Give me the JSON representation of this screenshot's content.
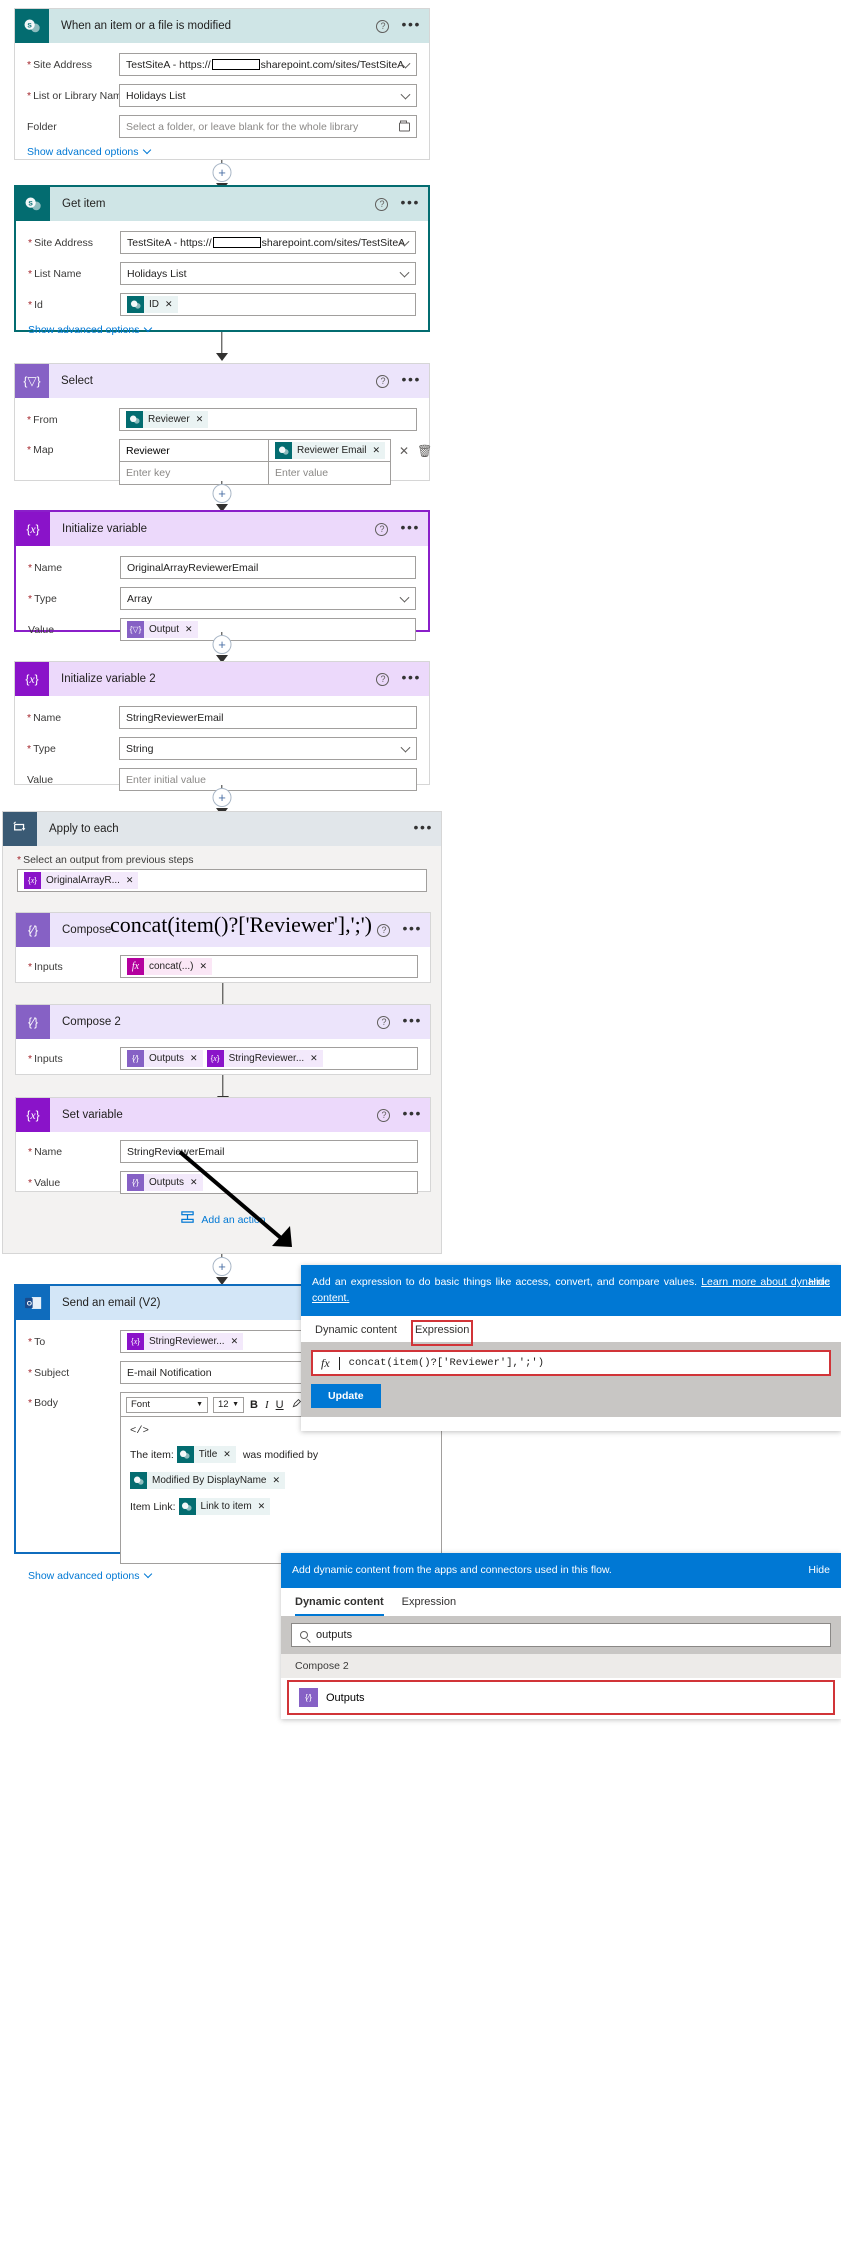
{
  "flow": {
    "trigger": {
      "title": "When an item or a file is modified",
      "icon": "sharepoint-icon",
      "fields": [
        {
          "label": "Site Address",
          "required": true,
          "value_pre": "TestSiteA - https://",
          "value_post": "sharepoint.com/sites/TestSiteA",
          "control": "dropdown"
        },
        {
          "label": "List or Library Name",
          "required": true,
          "value": "Holidays List",
          "control": "dropdown"
        },
        {
          "label": "Folder",
          "required": false,
          "placeholder": "Select a folder, or leave blank for the whole library",
          "control": "folder-picker"
        }
      ],
      "advanced_link": "Show advanced options"
    },
    "get_item": {
      "title": "Get item",
      "icon": "sharepoint-icon",
      "fields": [
        {
          "label": "Site Address",
          "required": true,
          "value_pre": "TestSiteA - https://",
          "value_post": "sharepoint.com/sites/TestSiteA",
          "control": "dropdown"
        },
        {
          "label": "List Name",
          "required": true,
          "value": "Holidays List",
          "control": "dropdown"
        },
        {
          "label": "Id",
          "required": true,
          "token": "ID",
          "token_icon": "sharepoint-icon"
        }
      ],
      "advanced_link": "Show advanced options"
    },
    "select": {
      "title": "Select",
      "icon": "select-icon",
      "from_label": "From",
      "from_token": "Reviewer",
      "map_label": "Map",
      "map_rows": [
        {
          "key": "Reviewer",
          "value_token": "Reviewer Email"
        },
        {
          "key_placeholder": "Enter key",
          "value_placeholder": "Enter value"
        }
      ]
    },
    "init_variable": {
      "title": "Initialize variable",
      "icon": "variable-icon",
      "name_label": "Name",
      "name_value": "OriginalArrayReviewerEmail",
      "type_label": "Type",
      "type_value": "Array",
      "value_label": "Value",
      "value_token": "Output"
    },
    "init_variable_2": {
      "title": "Initialize variable 2",
      "icon": "variable-icon",
      "name_label": "Name",
      "name_value": "StringReviewerEmail",
      "type_label": "Type",
      "type_value": "String",
      "value_label": "Value",
      "value_placeholder": "Enter initial value"
    },
    "apply_to_each": {
      "title": "Apply to each",
      "icon": "loop-icon",
      "select_output_label": "Select an output from previous steps",
      "select_output_token": "OriginalArrayR...",
      "add_action_label": "Add an action"
    },
    "compose": {
      "title": "Compose",
      "icon": "compose-icon",
      "inputs_label": "Inputs",
      "inputs_token": "concat(...)",
      "overlay_expression": "concat(item()?['Reviewer'],';')"
    },
    "compose_2": {
      "title": "Compose 2",
      "icon": "compose-icon",
      "inputs_label": "Inputs",
      "inputs_tokens": [
        "Outputs",
        "StringReviewer..."
      ]
    },
    "set_variable": {
      "title": "Set variable",
      "icon": "variable-icon",
      "name_label": "Name",
      "name_value": "StringReviewerEmail",
      "value_label": "Value",
      "value_token": "Outputs"
    },
    "send_email": {
      "title": "Send an email (V2)",
      "icon": "outlook-icon",
      "to_label": "To",
      "to_token": "StringReviewer...",
      "subject_label": "Subject",
      "subject_value": "E-mail Notification",
      "body_label": "Body",
      "advanced_link": "Show advanced options",
      "toolbar": {
        "font_name": "Font",
        "font_size": "12",
        "bold": "B",
        "italic": "I",
        "underline": "U",
        "highlight": "highlighter-icon",
        "bullet_list": "bullet-list-icon",
        "numbered_list": "numbered-list-icon",
        "align_left": "align-left-icon",
        "align_right": "align-right-icon",
        "link": "link-icon",
        "unlink": "unlink-icon",
        "code_view": "</>"
      },
      "body_content": {
        "code_marker": "</>",
        "line1_prefix": "The item:",
        "line1_token": "Title",
        "line1_suffix": "was modified by",
        "line2_token": "Modified By DisplayName",
        "line3_prefix": "Item Link:",
        "line3_token": "Link to item"
      }
    }
  },
  "expression_popup": {
    "banner_text_1": "Add an expression to do basic things like access, convert, and compare values.",
    "banner_link": "Learn more about dynamic content.",
    "hide_label": "Hide",
    "tabs": [
      {
        "label": "Dynamic content",
        "active": false
      },
      {
        "label": "Expression",
        "active": true,
        "highlighted": true
      }
    ],
    "expression_value": "concat(item()?['Reviewer'],';')",
    "fx_label": "fx",
    "update_label": "Update"
  },
  "dynamic_content_popup": {
    "banner_text": "Add dynamic content from the apps and connectors used in this flow.",
    "hide_label": "Hide",
    "tabs": [
      {
        "label": "Dynamic content",
        "active": true
      },
      {
        "label": "Expression",
        "active": false
      }
    ],
    "search_value": "outputs",
    "search_icon": "search-icon",
    "group_label": "Compose 2",
    "item_label": "Outputs",
    "item_highlighted": true
  },
  "colors": {
    "sharepoint_teal": "#036c70",
    "variable_purple": "#8a13c9",
    "compose_purple": "#8661c5",
    "outlook_blue": "#0f6cbd",
    "accent_blue": "#0078d4",
    "highlight_red": "#d13438",
    "required_red": "#a4262c"
  }
}
